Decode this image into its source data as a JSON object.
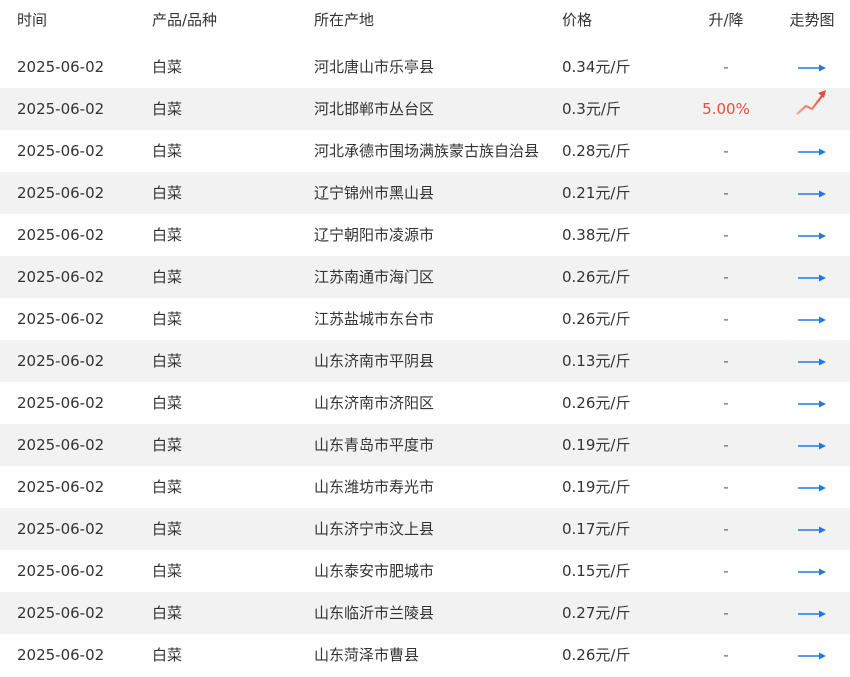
{
  "table": {
    "headers": {
      "date": "时间",
      "product": "产品/品种",
      "location": "所在产地",
      "price": "价格",
      "change": "升/降",
      "trend": "走势图"
    },
    "rows": [
      {
        "date": "2025-06-02",
        "product": "白菜",
        "location": "河北唐山市乐亭县",
        "price": "0.34元/斤",
        "change": "-",
        "trend": "flat-arrow-icon"
      },
      {
        "date": "2025-06-02",
        "product": "白菜",
        "location": "河北邯郸市丛台区",
        "price": "0.3元/斤",
        "change": "5.00%",
        "trend": "up-trend-icon"
      },
      {
        "date": "2025-06-02",
        "product": "白菜",
        "location": "河北承德市围场满族蒙古族自治县",
        "price": "0.28元/斤",
        "change": "-",
        "trend": "flat-arrow-icon"
      },
      {
        "date": "2025-06-02",
        "product": "白菜",
        "location": "辽宁锦州市黑山县",
        "price": "0.21元/斤",
        "change": "-",
        "trend": "flat-arrow-icon"
      },
      {
        "date": "2025-06-02",
        "product": "白菜",
        "location": "辽宁朝阳市凌源市",
        "price": "0.38元/斤",
        "change": "-",
        "trend": "flat-arrow-icon"
      },
      {
        "date": "2025-06-02",
        "product": "白菜",
        "location": "江苏南通市海门区",
        "price": "0.26元/斤",
        "change": "-",
        "trend": "flat-arrow-icon"
      },
      {
        "date": "2025-06-02",
        "product": "白菜",
        "location": "江苏盐城市东台市",
        "price": "0.26元/斤",
        "change": "-",
        "trend": "flat-arrow-icon"
      },
      {
        "date": "2025-06-02",
        "product": "白菜",
        "location": "山东济南市平阴县",
        "price": "0.13元/斤",
        "change": "-",
        "trend": "flat-arrow-icon"
      },
      {
        "date": "2025-06-02",
        "product": "白菜",
        "location": "山东济南市济阳区",
        "price": "0.26元/斤",
        "change": "-",
        "trend": "flat-arrow-icon"
      },
      {
        "date": "2025-06-02",
        "product": "白菜",
        "location": "山东青岛市平度市",
        "price": "0.19元/斤",
        "change": "-",
        "trend": "flat-arrow-icon"
      },
      {
        "date": "2025-06-02",
        "product": "白菜",
        "location": "山东潍坊市寿光市",
        "price": "0.19元/斤",
        "change": "-",
        "trend": "flat-arrow-icon"
      },
      {
        "date": "2025-06-02",
        "product": "白菜",
        "location": "山东济宁市汶上县",
        "price": "0.17元/斤",
        "change": "-",
        "trend": "flat-arrow-icon"
      },
      {
        "date": "2025-06-02",
        "product": "白菜",
        "location": "山东泰安市肥城市",
        "price": "0.15元/斤",
        "change": "-",
        "trend": "flat-arrow-icon"
      },
      {
        "date": "2025-06-02",
        "product": "白菜",
        "location": "山东临沂市兰陵县",
        "price": "0.27元/斤",
        "change": "-",
        "trend": "flat-arrow-icon"
      },
      {
        "date": "2025-06-02",
        "product": "白菜",
        "location": "山东菏泽市曹县",
        "price": "0.26元/斤",
        "change": "-",
        "trend": "flat-arrow-icon"
      }
    ]
  },
  "colors": {
    "up": "#e84c3d",
    "flat_arrow": "#1e7be6",
    "row_alt": "#f2f2f2"
  }
}
